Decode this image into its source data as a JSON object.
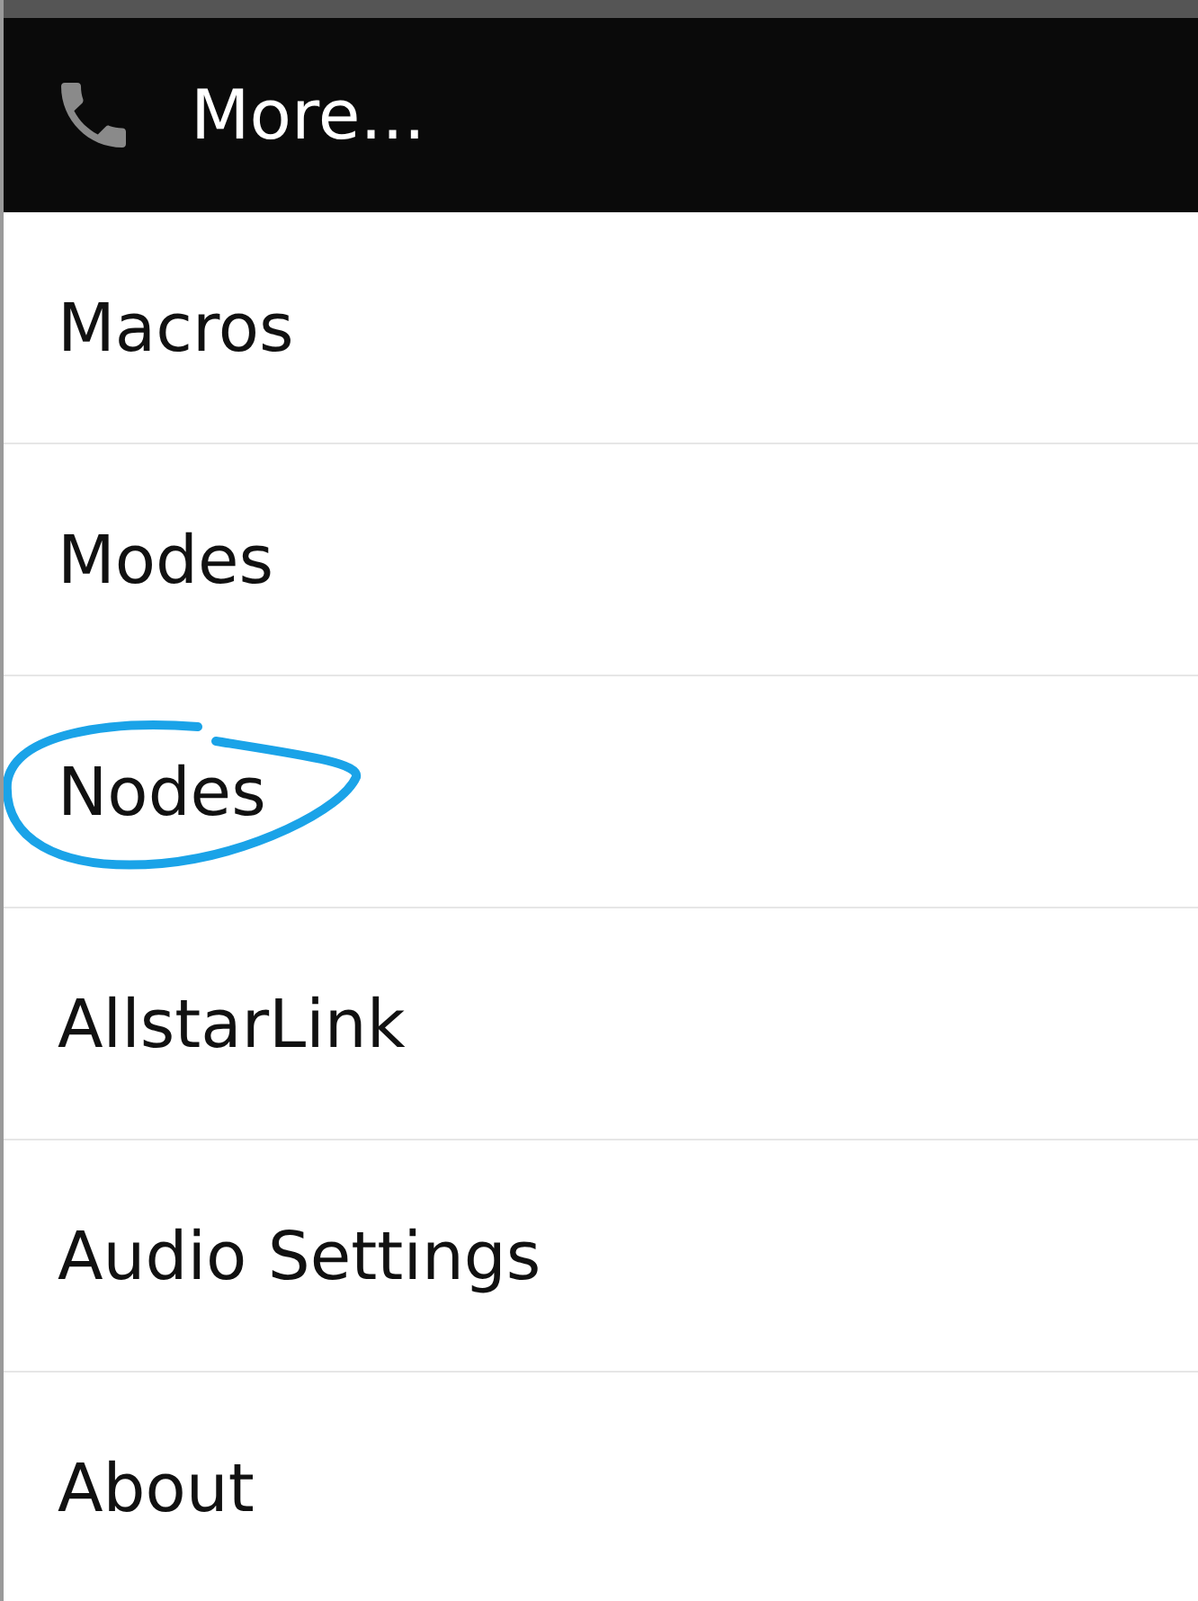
{
  "dialog": {
    "title": "More...",
    "items": [
      {
        "label": "Macros",
        "circled": false
      },
      {
        "label": "Modes",
        "circled": false
      },
      {
        "label": "Nodes",
        "circled": true
      },
      {
        "label": "AllstarLink",
        "circled": false
      },
      {
        "label": "Audio Settings",
        "circled": false
      },
      {
        "label": "About",
        "circled": false
      }
    ]
  }
}
